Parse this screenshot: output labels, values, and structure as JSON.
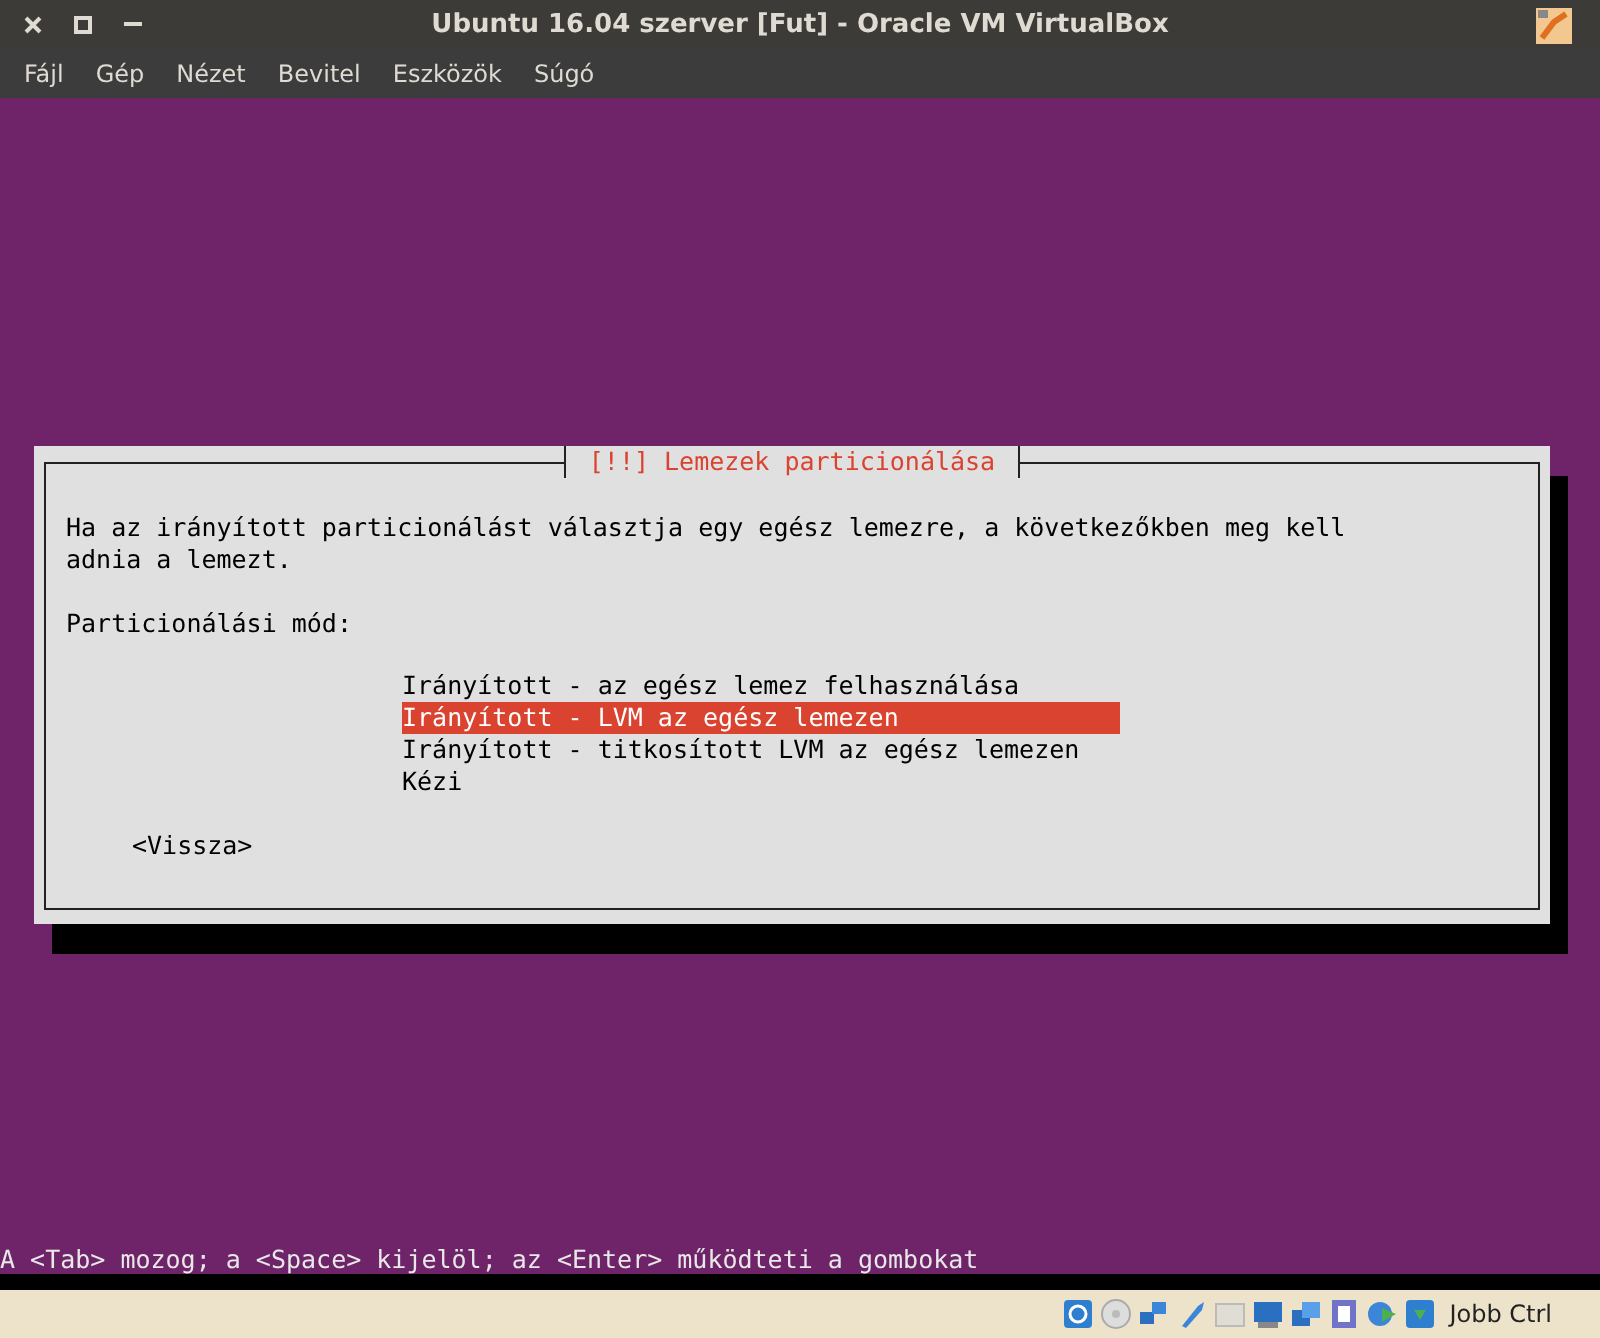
{
  "window": {
    "title": "Ubuntu 16.04 szerver [Fut] - Oracle VM VirtualBox"
  },
  "menu": [
    "Fájl",
    "Gép",
    "Nézet",
    "Bevitel",
    "Eszközök",
    "Súgó"
  ],
  "dialog": {
    "title": "[!!] Lemezek particionálása",
    "text_lines": [
      "Ha az irányított particionálást választja egy egész lemezre, a következőkben meg kell",
      "adnia a lemezt."
    ],
    "prompt": "Particionálási mód:",
    "options": [
      {
        "label": "Irányított - az egész lemez felhasználása",
        "selected": false
      },
      {
        "label": "Irányított - LVM az egész lemezen",
        "selected": true
      },
      {
        "label": "Irányított - titkosított LVM az egész lemezen",
        "selected": false
      },
      {
        "label": "Kézi",
        "selected": false
      }
    ],
    "back_button": "<Vissza>"
  },
  "hint": "A <Tab> mozog; a <Space> kijelöl; az <Enter> működteti a gombokat",
  "status_bar": {
    "host_key": "Jobb Ctrl"
  }
}
